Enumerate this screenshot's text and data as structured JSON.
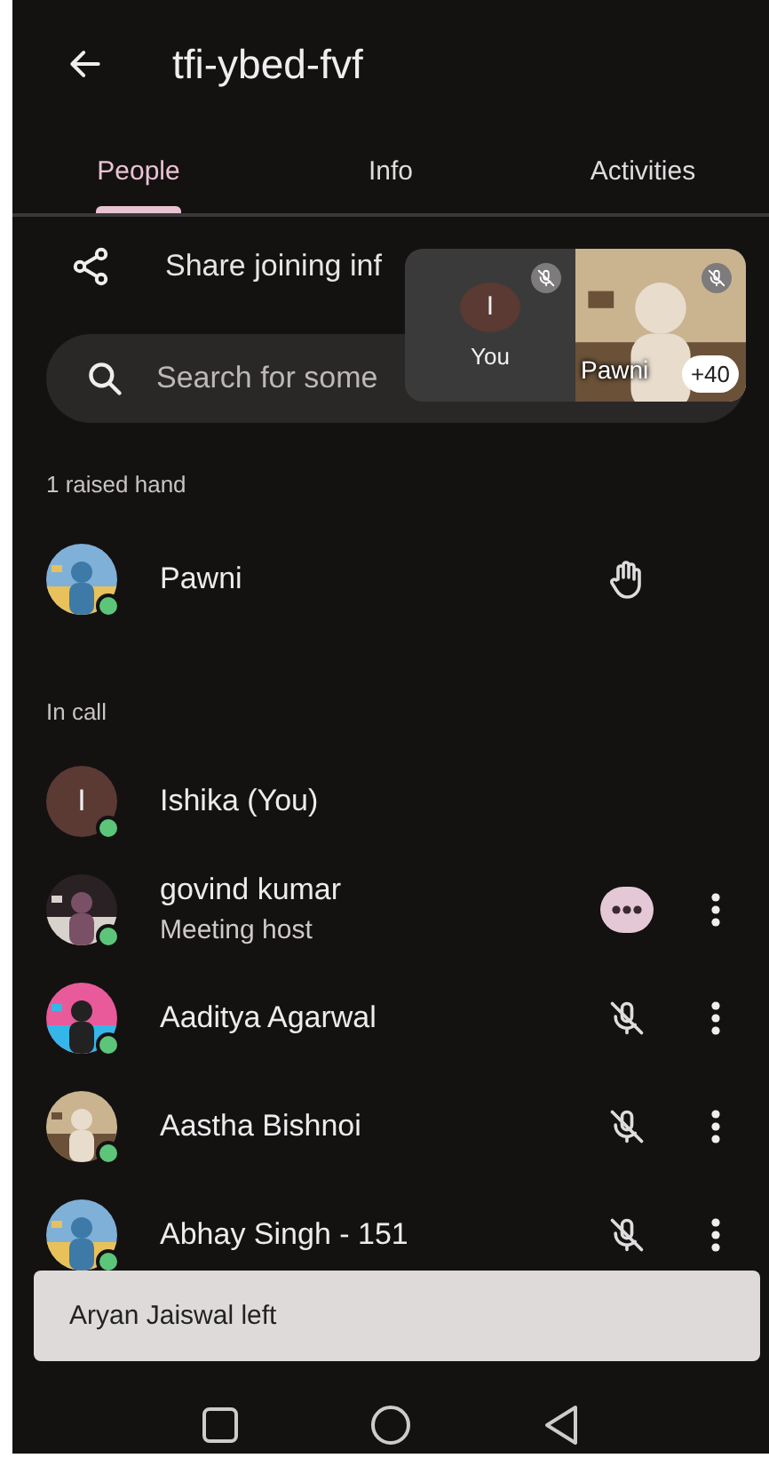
{
  "header": {
    "title": "tfi-ybed-fvf"
  },
  "tabs": [
    {
      "label": "People",
      "selected": true
    },
    {
      "label": "Info",
      "selected": false
    },
    {
      "label": "Activities",
      "selected": false
    }
  ],
  "share": {
    "label": "Share joining inf"
  },
  "search": {
    "placeholder": "Search for some"
  },
  "sections": [
    {
      "heading": "1 raised hand",
      "people": [
        {
          "name": "Pawni",
          "online": true,
          "hand_raised": true,
          "muted": false,
          "host_controls": false,
          "menu": false
        }
      ]
    },
    {
      "heading": "In call",
      "people": [
        {
          "name": "Ishika (You)",
          "avatar": {
            "kind": "letter",
            "letter": "I",
            "color": "#5a3a33"
          },
          "online": true,
          "hand_raised": false,
          "muted": false,
          "host_controls": false,
          "menu": false
        },
        {
          "name": "govind kumar",
          "subtitle": "Meeting host",
          "online": true,
          "hand_raised": false,
          "muted": false,
          "host_controls": true,
          "menu": true
        },
        {
          "name": "Aaditya Agarwal",
          "online": true,
          "hand_raised": false,
          "muted": true,
          "host_controls": false,
          "menu": true
        },
        {
          "name": "Aastha Bishnoi",
          "online": true,
          "hand_raised": false,
          "muted": true,
          "host_controls": false,
          "menu": true
        },
        {
          "name": "Abhay Singh - 151",
          "online": true,
          "hand_raised": false,
          "muted": true,
          "host_controls": false,
          "menu": true
        }
      ]
    }
  ],
  "tiles": [
    {
      "kind": "letter",
      "letter": "I",
      "label": "You",
      "muted": true
    },
    {
      "kind": "picture",
      "label": "Pawni",
      "muted": true,
      "badge": "+40"
    }
  ],
  "toast": {
    "text": "Aryan Jaiswal left"
  }
}
